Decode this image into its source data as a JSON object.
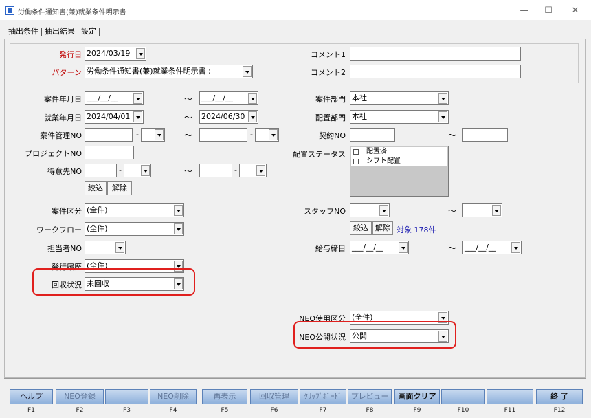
{
  "window": {
    "title": "労働条件通知書(兼)就業条件明示書",
    "minimize": "—",
    "maximize": "☐",
    "close": "✕"
  },
  "tabs": [
    {
      "label": "抽出条件"
    },
    {
      "label": "抽出結果"
    },
    {
      "label": "設定"
    }
  ],
  "header": {
    "issue_date": {
      "label": "発行日",
      "value": "2024/03/19"
    },
    "pattern": {
      "label": "パターン",
      "value": "労働条件通知書(兼)就業条件明示書 ;"
    },
    "comment1": {
      "label": "コメント1",
      "value": ""
    },
    "comment2": {
      "label": "コメント2",
      "value": ""
    }
  },
  "form": {
    "case_date": {
      "label": "案件年月日",
      "from": "___/__/__",
      "to": "___/__/__"
    },
    "work_date": {
      "label": "就業年月日",
      "from": "2024/04/01",
      "to": "2024/06/30"
    },
    "case_mgmt_no": {
      "label": "案件管理NO"
    },
    "project_no": {
      "label": "プロジェクトNO"
    },
    "client_no": {
      "label": "得意先NO"
    },
    "filter_btn": "絞込",
    "clear_btn": "解除",
    "case_category": {
      "label": "案件区分",
      "value": "(全件)"
    },
    "workflow": {
      "label": "ワークフロー",
      "value": "(全件)"
    },
    "staff_in_charge_no": {
      "label": "担当者NO"
    },
    "issue_history": {
      "label": "発行履歴",
      "value": "(全件)"
    },
    "collection_status": {
      "label": "回収状況",
      "value": "未回収"
    },
    "case_dept": {
      "label": "案件部門",
      "value": "本社"
    },
    "assign_dept": {
      "label": "配置部門",
      "value": "本社"
    },
    "contract_no": {
      "label": "契約NO"
    },
    "assign_status": {
      "label": "配置ステータス",
      "items": [
        "配置済",
        "シフト配置"
      ]
    },
    "staff_no": {
      "label": "スタッフNO"
    },
    "staff_filter_btn": "絞込",
    "staff_clear_btn": "解除",
    "target_count": "対象 178件",
    "pay_close_date": {
      "label": "給与締日",
      "from": "___/__/__",
      "to": "___/__/__"
    },
    "neo_use_category": {
      "label": "NEO使用区分",
      "value": "(全件)"
    },
    "neo_public_status": {
      "label": "NEO公開状況",
      "value": "公開"
    }
  },
  "fkeys": [
    {
      "key": "F1",
      "label": "ヘルプ"
    },
    {
      "key": "F2",
      "label": "NEO登録"
    },
    {
      "key": "F3",
      "label": ""
    },
    {
      "key": "F4",
      "label": "NEO削除"
    },
    {
      "key": "F5",
      "label": "再表示"
    },
    {
      "key": "F6",
      "label": "回収管理"
    },
    {
      "key": "F7",
      "label": "ｸﾘｯﾌﾟﾎﾞｰﾄﾞ"
    },
    {
      "key": "F8",
      "label": "プレビュー"
    },
    {
      "key": "F9",
      "label": "画面クリア"
    },
    {
      "key": "F10",
      "label": ""
    },
    {
      "key": "F11",
      "label": ""
    },
    {
      "key": "F12",
      "label": "終 了"
    }
  ],
  "colors": {
    "highlight": "#e0201e",
    "fkey_top": "#c7d9ef",
    "fkey_bottom": "#8fb1dc",
    "label_red": "#c00000"
  }
}
